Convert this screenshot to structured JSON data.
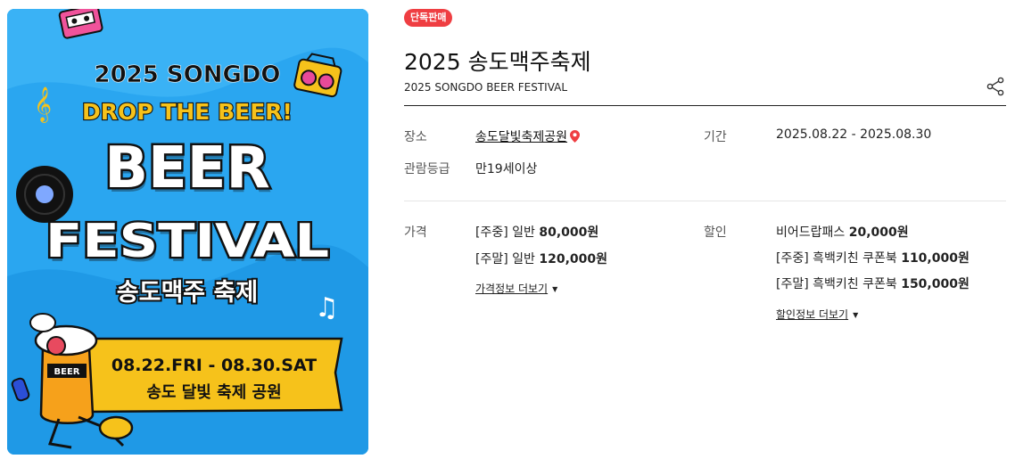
{
  "poster": {
    "line1": "2025 SONGDO",
    "line2": "DROP THE BEER!",
    "line3": "BEER",
    "line4": "FESTIVAL",
    "line5": "송도맥주 축제",
    "dates": "08.22.FRI - 08.30.SAT",
    "venue": "송도 달빛 축제 공원",
    "mascot_label": "BEER"
  },
  "badge": "단독판매",
  "title": "2025 송도맥주축제",
  "subtitle": "2025 SONGDO BEER FESTIVAL",
  "info": {
    "place_label": "장소",
    "place_value": "송도달빛축제공원",
    "period_label": "기간",
    "period_value": "2025.08.22 - 2025.08.30",
    "rating_label": "관람등급",
    "rating_value": "만19세이상"
  },
  "price": {
    "label": "가격",
    "rows": [
      {
        "tag": "[주중] 일반",
        "amount": "80,000원"
      },
      {
        "tag": "[주말] 일반",
        "amount": "120,000원"
      }
    ],
    "more": "가격정보 더보기"
  },
  "discount": {
    "label": "할인",
    "rows": [
      {
        "tag": "비어드랍패스",
        "amount": "20,000원"
      },
      {
        "tag": "[주중] 흑백키친 쿠폰북",
        "amount": "110,000원"
      },
      {
        "tag": "[주말] 흑백키친 쿠폰북",
        "amount": "150,000원"
      }
    ],
    "more": "할인정보 더보기"
  },
  "colors": {
    "badge": "#ef3e42",
    "poster_bg": "#2aa6f0",
    "poster_yellow": "#f6c21b"
  },
  "icons": [
    "share-icon",
    "location-pin-icon",
    "caret-down-icon"
  ]
}
